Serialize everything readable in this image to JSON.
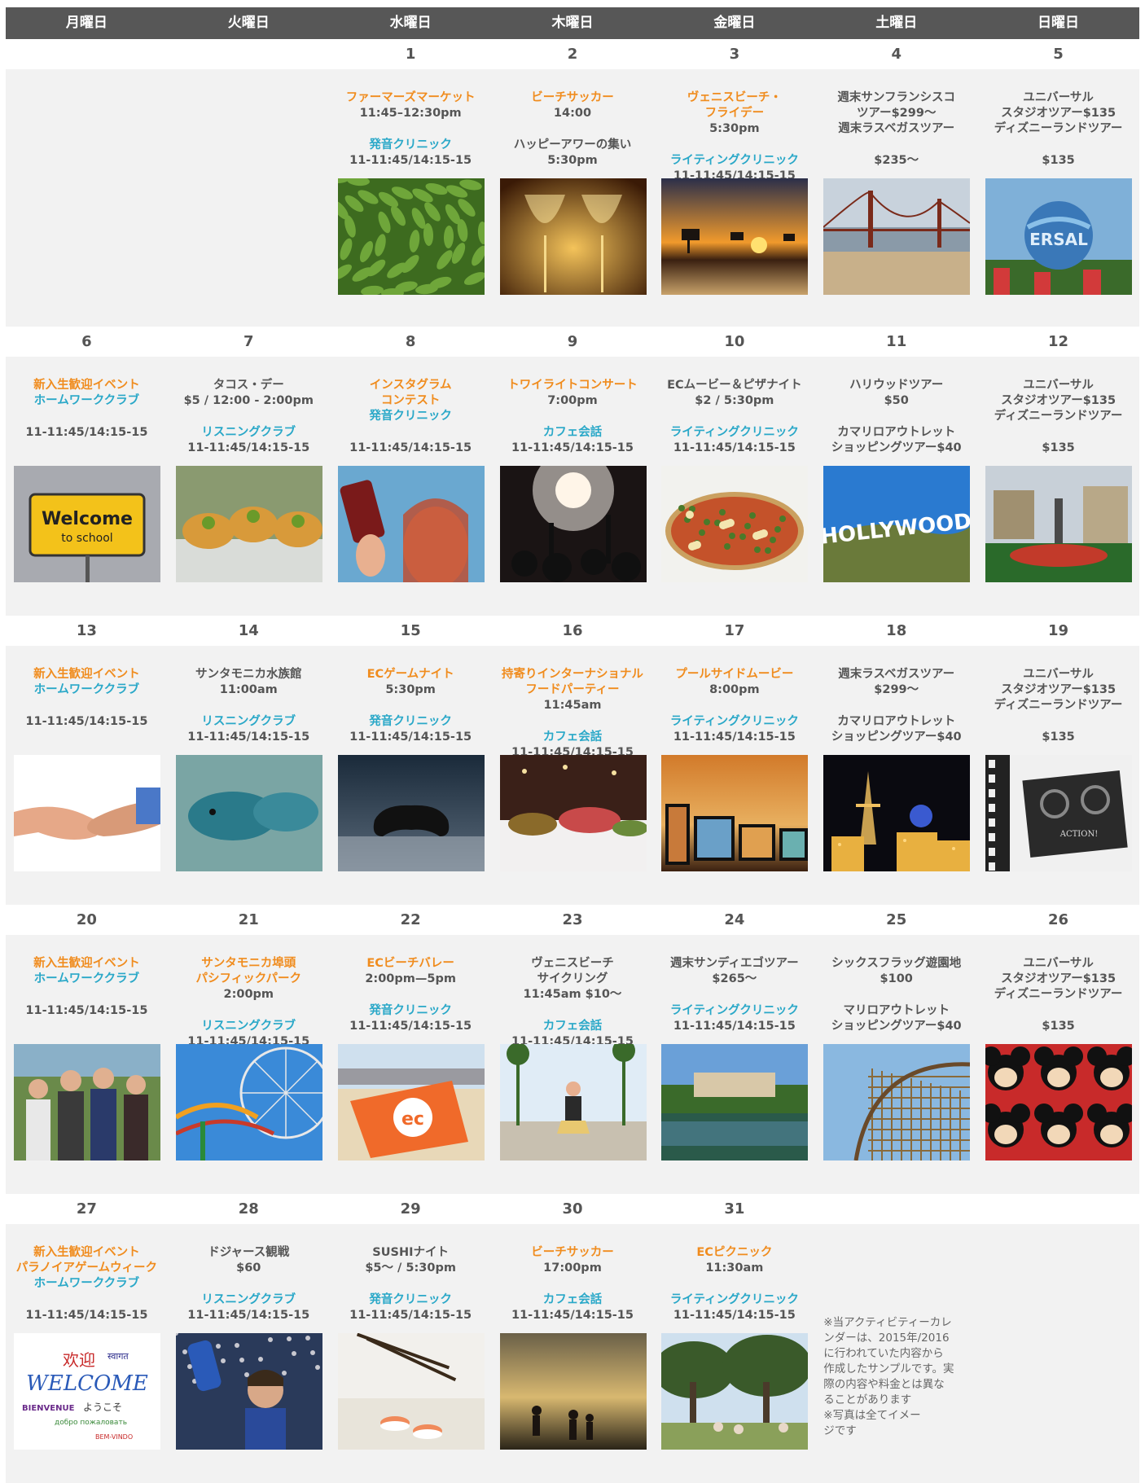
{
  "header": {
    "days": [
      "月曜日",
      "火曜日",
      "水曜日",
      "木曜日",
      "金曜日",
      "土曜日",
      "日曜日"
    ]
  },
  "colors": {
    "header_bg": "#575757",
    "orange": "#f08c1e",
    "teal": "#2aa8c8",
    "gray_text": "#555555",
    "cell_bg": "#f2f2f2"
  },
  "weeks": [
    {
      "days": [
        {
          "num": "",
          "events": []
        },
        {
          "num": "",
          "events": []
        },
        {
          "num": "1",
          "photo": "green-peppers",
          "events": [
            {
              "color": "orange",
              "lines": [
                "ファーマーズマーケット"
              ]
            },
            {
              "color": "gray",
              "lines": [
                "11:45–12:30pm"
              ]
            },
            {
              "color": "teal",
              "lines": [
                "発音クリニック"
              ]
            },
            {
              "color": "gray",
              "lines": [
                "11-11:45/14:15-15"
              ]
            }
          ]
        },
        {
          "num": "2",
          "photo": "wine-glasses",
          "events": [
            {
              "color": "orange",
              "lines": [
                "ビーチサッカー"
              ]
            },
            {
              "color": "gray",
              "lines": [
                "14:00"
              ]
            },
            {
              "color": "gray",
              "lines": [
                "ハッピーアワーの集い"
              ]
            },
            {
              "color": "gray",
              "lines": [
                "5:30pm"
              ]
            }
          ]
        },
        {
          "num": "3",
          "photo": "beach-sunset",
          "events": [
            {
              "color": "orange",
              "lines": [
                "ヴェニスビーチ・",
                "フライデー"
              ]
            },
            {
              "color": "gray",
              "lines": [
                "5:30pm"
              ]
            },
            {
              "color": "teal",
              "lines": [
                "ライティングクリニック"
              ]
            },
            {
              "color": "gray",
              "lines": [
                "11-11:45/14:15-15"
              ]
            }
          ]
        },
        {
          "num": "4",
          "photo": "golden-gate",
          "events": [
            {
              "color": "gray",
              "lines": [
                "週末サンフランシスコ",
                "ツアー$299〜"
              ]
            },
            {
              "color": "gray",
              "lines": [
                "週末ラスベガスツアー"
              ]
            },
            {
              "color": "gray",
              "lines": [
                "$235〜"
              ]
            }
          ]
        },
        {
          "num": "5",
          "photo": "universal-globe",
          "events": [
            {
              "color": "gray",
              "lines": [
                "ユニバーサル",
                "スタジオツアー$135"
              ]
            },
            {
              "color": "gray",
              "lines": [
                "ディズニーランドツアー"
              ]
            },
            {
              "color": "gray",
              "lines": [
                "$135"
              ]
            }
          ]
        }
      ]
    },
    {
      "days": [
        {
          "num": "6",
          "photo": "welcome-sign",
          "events": [
            {
              "color": "orange",
              "lines": [
                "新入生歓迎イベント"
              ]
            },
            {
              "color": "teal",
              "lines": [
                "ホームワーククラブ"
              ]
            },
            {
              "color": "gray",
              "lines": [
                "11-11:45/14:15-15"
              ]
            }
          ]
        },
        {
          "num": "7",
          "photo": "tacos",
          "events": [
            {
              "color": "gray",
              "lines": [
                "タコス・デー"
              ]
            },
            {
              "color": "gray",
              "lines": [
                "$5 / 12:00 - 2:00pm"
              ]
            },
            {
              "color": "teal",
              "lines": [
                "リスニングクラブ"
              ]
            },
            {
              "color": "gray",
              "lines": [
                "11-11:45/14:15-15"
              ]
            }
          ]
        },
        {
          "num": "8",
          "photo": "selfie",
          "events": [
            {
              "color": "orange",
              "lines": [
                "インスタグラム",
                "コンテスト"
              ]
            },
            {
              "color": "teal",
              "lines": [
                "発音クリニック"
              ]
            },
            {
              "color": "gray",
              "lines": [
                "11-11:45/14:15-15"
              ]
            }
          ]
        },
        {
          "num": "9",
          "photo": "concert",
          "events": [
            {
              "color": "orange",
              "lines": [
                "トワイライトコンサート"
              ]
            },
            {
              "color": "gray",
              "lines": [
                "7:00pm"
              ]
            },
            {
              "color": "teal",
              "lines": [
                "カフェ会話"
              ]
            },
            {
              "color": "gray",
              "lines": [
                "11-11:45/14:15-15"
              ]
            }
          ]
        },
        {
          "num": "10",
          "photo": "pizza",
          "events": [
            {
              "color": "gray",
              "lines": [
                "ECムービー＆ピザナイト"
              ]
            },
            {
              "color": "gray",
              "lines": [
                "$2 / 5:30pm"
              ]
            },
            {
              "color": "teal",
              "lines": [
                "ライティングクリニック"
              ]
            },
            {
              "color": "gray",
              "lines": [
                "11-11:45/14:15-15"
              ]
            }
          ]
        },
        {
          "num": "11",
          "photo": "hollywood-sign",
          "events": [
            {
              "color": "gray",
              "lines": [
                "ハリウッドツアー"
              ]
            },
            {
              "color": "gray",
              "lines": [
                "$50"
              ]
            },
            {
              "color": "gray",
              "lines": [
                "カマリロアウトレット"
              ]
            },
            {
              "color": "gray",
              "lines": [
                "ショッピングツアー$40"
              ]
            }
          ]
        },
        {
          "num": "12",
          "photo": "studio-park",
          "events": [
            {
              "color": "gray",
              "lines": [
                "ユニバーサル",
                "スタジオツアー$135"
              ]
            },
            {
              "color": "gray",
              "lines": [
                "ディズニーランドツアー"
              ]
            },
            {
              "color": "gray",
              "lines": [
                "$135"
              ]
            }
          ]
        }
      ]
    },
    {
      "days": [
        {
          "num": "13",
          "photo": "handshake",
          "events": [
            {
              "color": "orange",
              "lines": [
                "新入生歓迎イベント"
              ]
            },
            {
              "color": "teal",
              "lines": [
                "ホームワーククラブ"
              ]
            },
            {
              "color": "gray",
              "lines": [
                "11-11:45/14:15-15"
              ]
            }
          ]
        },
        {
          "num": "14",
          "photo": "aquarium-fish",
          "events": [
            {
              "color": "gray",
              "lines": [
                "サンタモニカ水族館"
              ]
            },
            {
              "color": "gray",
              "lines": [
                "11:00am"
              ]
            },
            {
              "color": "teal",
              "lines": [
                "リスニングクラブ"
              ]
            },
            {
              "color": "gray",
              "lines": [
                "11-11:45/14:15-15"
              ]
            }
          ]
        },
        {
          "num": "15",
          "photo": "game-controller",
          "events": [
            {
              "color": "orange",
              "lines": [
                "ECゲームナイト"
              ]
            },
            {
              "color": "gray",
              "lines": [
                "5:30pm"
              ]
            },
            {
              "color": "teal",
              "lines": [
                "発音クリニック"
              ]
            },
            {
              "color": "gray",
              "lines": [
                "11-11:45/14:15-15"
              ]
            }
          ]
        },
        {
          "num": "16",
          "photo": "buffet",
          "events": [
            {
              "color": "orange",
              "lines": [
                "持寄りインターナショナル",
                "フードパーティー"
              ]
            },
            {
              "color": "gray",
              "lines": [
                "11:45am"
              ]
            },
            {
              "color": "teal",
              "lines": [
                "カフェ会話"
              ]
            },
            {
              "color": "gray",
              "lines": [
                "11-11:45/14:15-15"
              ]
            }
          ]
        },
        {
          "num": "17",
          "photo": "movie-screens",
          "events": [
            {
              "color": "orange",
              "lines": [
                "プールサイドムービー"
              ]
            },
            {
              "color": "gray",
              "lines": [
                "8:00pm"
              ]
            },
            {
              "color": "teal",
              "lines": [
                "ライティングクリニック"
              ]
            },
            {
              "color": "gray",
              "lines": [
                "11-11:45/14:15-15"
              ]
            }
          ]
        },
        {
          "num": "18",
          "photo": "las-vegas",
          "events": [
            {
              "color": "gray",
              "lines": [
                "週末ラスベガスツアー"
              ]
            },
            {
              "color": "gray",
              "lines": [
                "$299〜"
              ]
            },
            {
              "color": "gray",
              "lines": [
                "カマリロアウトレット"
              ]
            },
            {
              "color": "gray",
              "lines": [
                "ショッピングツアー$40"
              ]
            }
          ]
        },
        {
          "num": "19",
          "photo": "film-projector",
          "events": [
            {
              "color": "gray",
              "lines": [
                "ユニバーサル",
                "スタジオツアー$135"
              ]
            },
            {
              "color": "gray",
              "lines": [
                "ディズニーランドツアー"
              ]
            },
            {
              "color": "gray",
              "lines": [
                "$135"
              ]
            }
          ]
        }
      ]
    },
    {
      "days": [
        {
          "num": "20",
          "photo": "group-friends",
          "events": [
            {
              "color": "orange",
              "lines": [
                "新入生歓迎イベント"
              ]
            },
            {
              "color": "teal",
              "lines": [
                "ホームワーククラブ"
              ]
            },
            {
              "color": "gray",
              "lines": [
                "11-11:45/14:15-15"
              ]
            }
          ]
        },
        {
          "num": "21",
          "photo": "ferris-wheel",
          "events": [
            {
              "color": "orange",
              "lines": [
                "サンタモニカ埠頭",
                "パシフィックパーク"
              ]
            },
            {
              "color": "gray",
              "lines": [
                "2:00pm"
              ]
            },
            {
              "color": "teal",
              "lines": [
                "リスニングクラブ"
              ]
            },
            {
              "color": "gray",
              "lines": [
                "11-11:45/14:15-15"
              ]
            }
          ]
        },
        {
          "num": "22",
          "photo": "beach-flag",
          "events": [
            {
              "color": "orange",
              "lines": [
                "ECビーチバレー"
              ]
            },
            {
              "color": "gray",
              "lines": [
                "2:00pm—5pm"
              ]
            },
            {
              "color": "teal",
              "lines": [
                "発音クリニック"
              ]
            },
            {
              "color": "gray",
              "lines": [
                "11-11:45/14:15-15"
              ]
            }
          ]
        },
        {
          "num": "23",
          "photo": "bike-palms",
          "events": [
            {
              "color": "gray",
              "lines": [
                "ヴェニスビーチ",
                "サイクリング"
              ]
            },
            {
              "color": "gray",
              "lines": [
                "11:45am $10〜"
              ]
            },
            {
              "color": "teal",
              "lines": [
                "カフェ会話"
              ]
            },
            {
              "color": "gray",
              "lines": [
                "11-11:45/14:15-15"
              ]
            }
          ]
        },
        {
          "num": "24",
          "photo": "balboa-park",
          "events": [
            {
              "color": "gray",
              "lines": [
                "週末サンディエゴツアー"
              ]
            },
            {
              "color": "gray",
              "lines": [
                "$265〜"
              ]
            },
            {
              "color": "teal",
              "lines": [
                "ライティングクリニック"
              ]
            },
            {
              "color": "gray",
              "lines": [
                "11-11:45/14:15-15"
              ]
            }
          ]
        },
        {
          "num": "25",
          "photo": "roller-coaster",
          "events": [
            {
              "color": "gray",
              "lines": [
                "シックスフラッグ遊園地"
              ]
            },
            {
              "color": "gray",
              "lines": [
                "$100"
              ]
            },
            {
              "color": "gray",
              "lines": [
                "マリロアウトレット"
              ]
            },
            {
              "color": "gray",
              "lines": [
                "ショッピングツアー$40"
              ]
            }
          ]
        },
        {
          "num": "26",
          "photo": "mickey-plush",
          "events": [
            {
              "color": "gray",
              "lines": [
                "ユニバーサル",
                "スタジオツアー$135"
              ]
            },
            {
              "color": "gray",
              "lines": [
                "ディズニーランドツアー"
              ]
            },
            {
              "color": "gray",
              "lines": [
                "$135"
              ]
            }
          ]
        }
      ]
    },
    {
      "days": [
        {
          "num": "27",
          "photo": "welcome-words",
          "events": [
            {
              "color": "orange",
              "lines": [
                "新入生歓迎イベント",
                "パラノイアゲームウィーク"
              ]
            },
            {
              "color": "teal",
              "lines": [
                "ホームワーククラブ"
              ]
            },
            {
              "color": "gray",
              "lines": [
                "11-11:45/14:15-15"
              ]
            }
          ]
        },
        {
          "num": "28",
          "photo": "dodgers-fan",
          "events": [
            {
              "color": "gray",
              "lines": [
                "ドジャース観戦"
              ]
            },
            {
              "color": "gray",
              "lines": [
                "$60"
              ]
            },
            {
              "color": "teal",
              "lines": [
                "リスニングクラブ"
              ]
            },
            {
              "color": "gray",
              "lines": [
                "11-11:45/14:15-15"
              ]
            }
          ]
        },
        {
          "num": "29",
          "photo": "sushi",
          "events": [
            {
              "color": "gray",
              "lines": [
                "SUSHIナイト"
              ]
            },
            {
              "color": "gray",
              "lines": [
                "$5〜 / 5:30pm"
              ]
            },
            {
              "color": "teal",
              "lines": [
                "発音クリニック"
              ]
            },
            {
              "color": "gray",
              "lines": [
                "11-11:45/14:15-15"
              ]
            }
          ]
        },
        {
          "num": "30",
          "photo": "beach-soccer",
          "events": [
            {
              "color": "orange",
              "lines": [
                "ビーチサッカー"
              ]
            },
            {
              "color": "gray",
              "lines": [
                "17:00pm"
              ]
            },
            {
              "color": "teal",
              "lines": [
                "カフェ会話"
              ]
            },
            {
              "color": "gray",
              "lines": [
                "11-11:45/14:15-15"
              ]
            }
          ]
        },
        {
          "num": "31",
          "photo": "picnic-park",
          "events": [
            {
              "color": "orange",
              "lines": [
                "ECピクニック"
              ]
            },
            {
              "color": "gray",
              "lines": [
                "11:30am"
              ]
            },
            {
              "color": "teal",
              "lines": [
                "ライティングクリニック"
              ]
            },
            {
              "color": "gray",
              "lines": [
                "11-11:45/14:15-15"
              ]
            }
          ]
        },
        {
          "num": "",
          "events": [],
          "note": [
            "※当アクティビティーカレ",
            "ンダーは、2015年/2016",
            "に行われていた内容から",
            "作成したサンプルです。実",
            "際の内容や料金とは異な",
            "ることがあります",
            "※写真は全てイメー",
            "ジです"
          ]
        },
        {
          "num": "",
          "events": []
        }
      ]
    }
  ]
}
